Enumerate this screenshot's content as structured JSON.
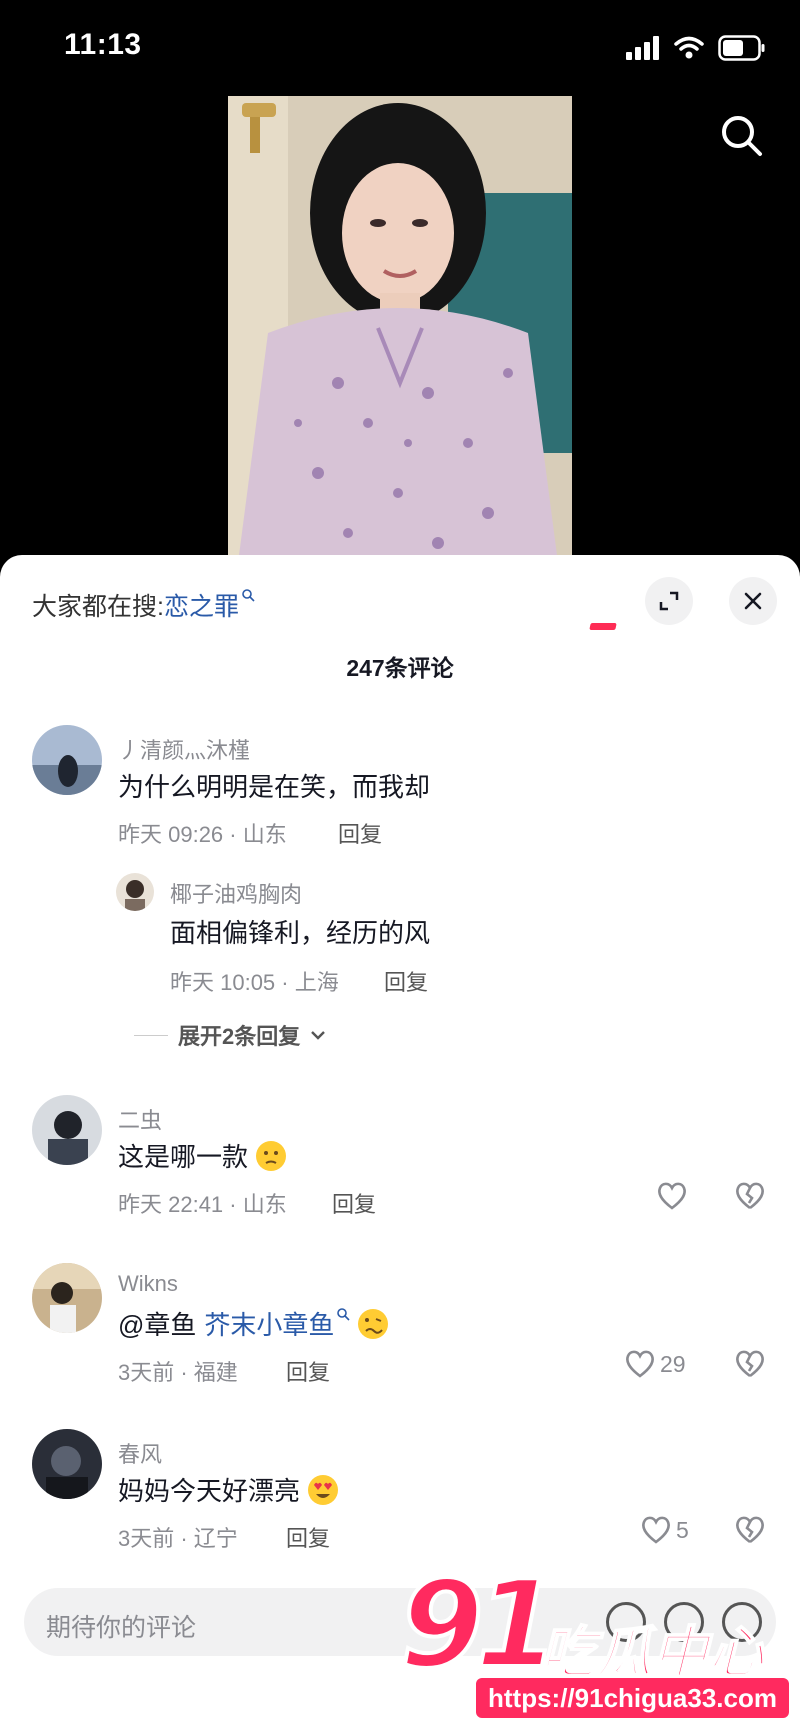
{
  "status_bar": {
    "time": "11:13"
  },
  "comments_panel": {
    "trending_label": "大家都在搜:",
    "trending_keyword": "恋之罪",
    "comment_count": "247条评论",
    "accent_color": "#fe2c55"
  },
  "comments": [
    {
      "username": "丿清颜灬沐槿",
      "text": "为什么明明是在笑，而我却",
      "time_location": "昨天 09:26 · 山东",
      "reply_label": "回复",
      "reply": {
        "username": "椰子油鸡胸肉",
        "text": "面相偏锋利，经历的风",
        "time_location": "昨天 10:05 · 上海",
        "reply_label": "回复"
      },
      "expand_label": "展开2条回复"
    },
    {
      "username": "二虫",
      "text": "这是哪一款",
      "emoji": "thinking-face",
      "time_location": "昨天 22:41 · 山东",
      "reply_label": "回复",
      "likes": ""
    },
    {
      "username": "Wikns",
      "text_prefix": "@章鱼",
      "mention": "芥末小章鱼",
      "emoji": "woozy-face",
      "time_location": "3天前 · 福建",
      "reply_label": "回复",
      "likes": "29"
    },
    {
      "username": "春风",
      "text": "妈妈今天好漂亮",
      "emoji": "heart-eyes",
      "time_location": "3天前 · 辽宁",
      "reply_label": "回复",
      "likes": "5"
    }
  ],
  "input": {
    "placeholder": "期待你的评论"
  },
  "watermark": {
    "number": "91",
    "name": "吃瓜中心",
    "url": "https://91chigua33.com"
  }
}
